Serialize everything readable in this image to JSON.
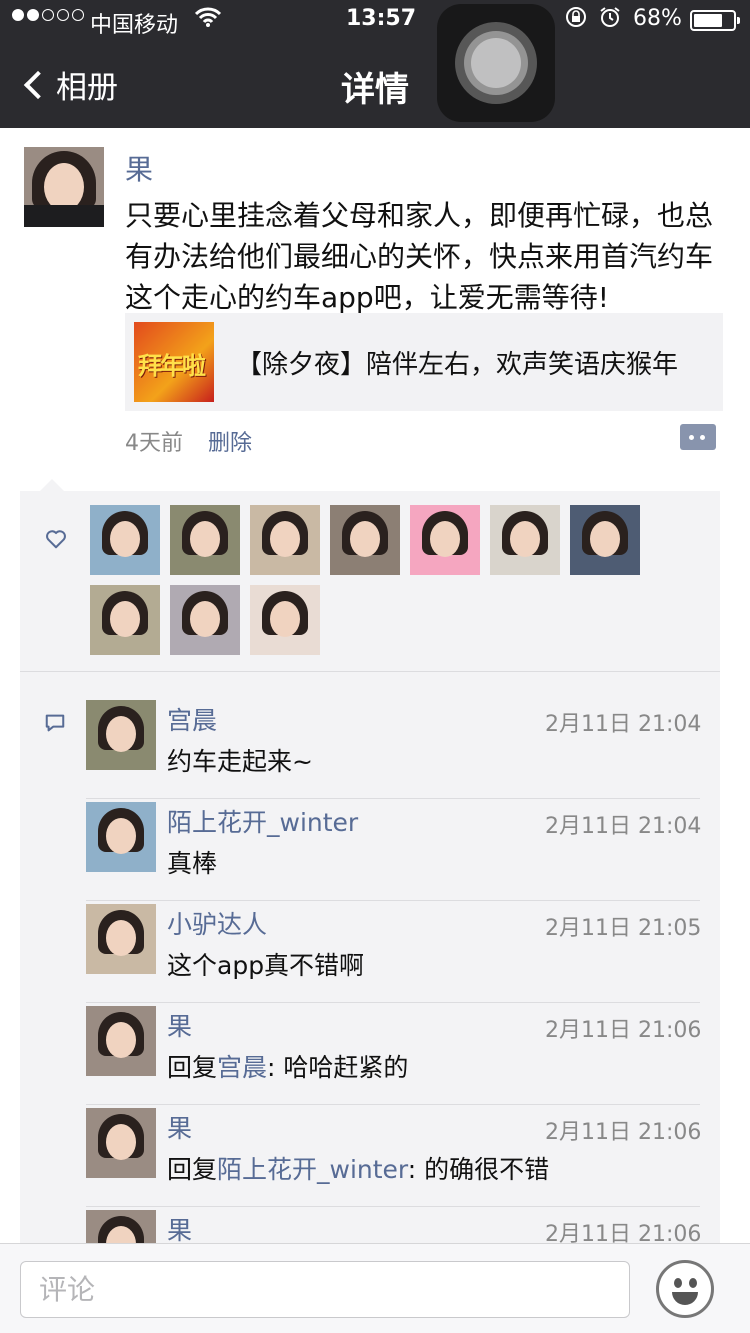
{
  "status_bar": {
    "carrier": "中国移动",
    "time": "13:57",
    "battery": "68%"
  },
  "nav": {
    "back_label": "相册",
    "title": "详情"
  },
  "post": {
    "author": "果",
    "text": "只要心里挂念着父母和家人，即便再忙碌，也总有办法给他们最细心的关怀，快点来用首汽约车 这个走心的约车app吧，让爱无需等待!",
    "share": {
      "thumb_text": "拜年啦",
      "title": "【除夕夜】陪伴左右，欢声笑语庆猴年"
    },
    "time": "4天前",
    "delete_label": "删除"
  },
  "likes": [
    {
      "name": "avatar-like-1",
      "bg": "#8fb0c9"
    },
    {
      "name": "avatar-like-2",
      "bg": "#8a8a70"
    },
    {
      "name": "avatar-like-3",
      "bg": "#c9b9a4"
    },
    {
      "name": "avatar-like-4",
      "bg": "#8c7f74"
    },
    {
      "name": "avatar-like-5",
      "bg": "#f5a6c0"
    },
    {
      "name": "avatar-like-6",
      "bg": "#d9d4cc"
    },
    {
      "name": "avatar-like-7",
      "bg": "#4e5c73"
    },
    {
      "name": "avatar-like-8",
      "bg": "#b3ab93"
    },
    {
      "name": "avatar-like-9",
      "bg": "#b0aab2"
    },
    {
      "name": "avatar-like-10",
      "bg": "#e9dcd4"
    }
  ],
  "comments": [
    {
      "name": "宫晨",
      "time": "2月11日 21:04",
      "text": "约车走起来~",
      "reply_prefix": "",
      "reply_to": "",
      "reply_suffix": ""
    },
    {
      "name": "陌上花开_winter",
      "time": "2月11日 21:04",
      "text": "真棒",
      "reply_prefix": "",
      "reply_to": "",
      "reply_suffix": ""
    },
    {
      "name": "小驴达人",
      "time": "2月11日 21:05",
      "text": "这个app真不错啊",
      "reply_prefix": "",
      "reply_to": "",
      "reply_suffix": ""
    },
    {
      "name": "果",
      "time": "2月11日 21:06",
      "text": "",
      "reply_prefix": "回复",
      "reply_to": "宫晨",
      "reply_suffix": ": 哈哈赶紧的"
    },
    {
      "name": "果",
      "time": "2月11日 21:06",
      "text": "",
      "reply_prefix": "回复",
      "reply_to": "陌上花开_winter",
      "reply_suffix": ": 的确很不错"
    },
    {
      "name": "果",
      "time": "2月11日 21:06",
      "text": "",
      "reply_prefix": "",
      "reply_to": "",
      "reply_suffix": ""
    }
  ],
  "input": {
    "placeholder": "评论"
  }
}
